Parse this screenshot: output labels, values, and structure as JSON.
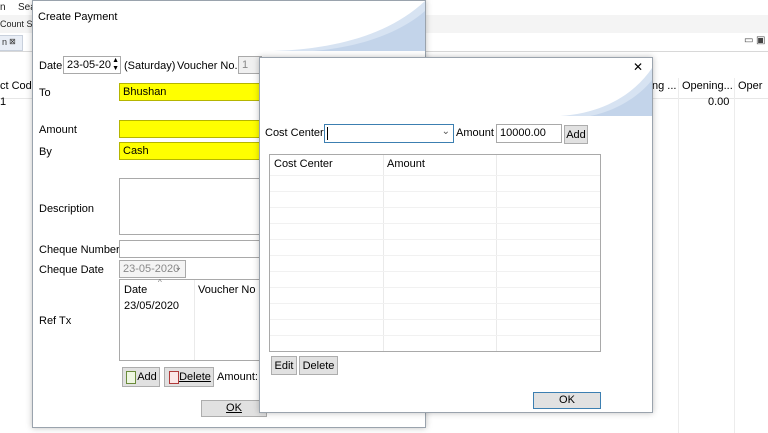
{
  "background": {
    "menu": [
      "n",
      "Sea"
    ],
    "toolbar_text": "Count Sn",
    "tab_label": "n",
    "grid_headers": [
      "ct Code",
      "ng ...",
      "Opening...",
      "Oper"
    ],
    "grid_row": [
      "1",
      "0.00"
    ]
  },
  "payment": {
    "title": "Create Payment",
    "date_label": "Date",
    "date_value": "23-05-20",
    "day_text": "(Saturday)",
    "voucher_label": "Voucher No.",
    "voucher_value": "1",
    "to_label": "To",
    "to_value": "Bhushan",
    "amount_label": "Amount",
    "amount_value": "",
    "by_label": "By",
    "by_value": "Cash",
    "description_label": "Description",
    "cheque_number_label": "Cheque Number",
    "cheque_date_label": "Cheque Date",
    "cheque_date_value": "23-05-2020",
    "ref_tx_label": "Ref Tx",
    "ref_columns": [
      "Date",
      "Voucher No"
    ],
    "ref_rows": [
      [
        "23/05/2020",
        ""
      ]
    ],
    "add_label": "Add",
    "delete_label": "Delete",
    "amount_footer_label": "Amount:",
    "ok_label": "OK"
  },
  "cost_center_dialog": {
    "cost_center_label": "Cost Center",
    "cost_center_value": "",
    "amount_label": "Amount",
    "amount_value": "10000.00",
    "add_label": "Add",
    "table_columns": [
      "Cost Center",
      "Amount"
    ],
    "edit_label": "Edit",
    "delete_label": "Delete",
    "ok_label": "OK",
    "close_symbol": "✕"
  },
  "colors": {
    "required_field": "#ffff00",
    "accent": "#d7e3f2"
  }
}
